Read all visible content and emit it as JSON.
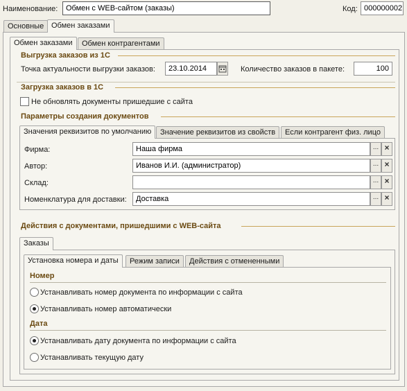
{
  "header": {
    "name_label": "Наименование:",
    "name_value": "Обмен с WEB-сайтом (заказы)",
    "code_label": "Код:",
    "code_value": "000000002"
  },
  "main_tabs": [
    {
      "label": "Основные"
    },
    {
      "label": "Обмен заказами"
    }
  ],
  "sub_tabs": [
    {
      "label": "Обмен заказами"
    },
    {
      "label": "Обмен контрагентами"
    }
  ],
  "export": {
    "title": "Выгрузка заказов из 1С",
    "date_label": "Точка актуальности выгрузки заказов:",
    "date_value": "23.10.2014",
    "packet_label": "Количество заказов в пакете:",
    "packet_value": "100"
  },
  "import": {
    "title": "Загрузка заказов в 1С",
    "checkbox_label": "Не обновлять документы пришедшие с сайта",
    "params_title": "Параметры создания документов",
    "param_tabs": [
      {
        "label": "Значения реквизитов по умолчанию"
      },
      {
        "label": "Значение реквизитов из свойств"
      },
      {
        "label": "Если контрагент физ. лицо"
      }
    ],
    "fields": [
      {
        "label": "Фирма:",
        "value": "Наша фирма"
      },
      {
        "label": "Автор:",
        "value": "Иванов И.И. (администратор)"
      },
      {
        "label": "Склад:",
        "value": ""
      },
      {
        "label": "Номенклатура для доставки:",
        "value": "Доставка"
      }
    ],
    "ellipsis": "...",
    "clear": "×"
  },
  "actions": {
    "title": "Действия с документами, пришедшими с WEB-сайта",
    "orders_tab": "Заказы",
    "inner_tabs": [
      {
        "label": "Установка номера и даты"
      },
      {
        "label": "Режим записи"
      },
      {
        "label": "Действия с отмененными"
      }
    ],
    "number_title": "Номер",
    "number_options": [
      {
        "label": "Устанавливать номер документа по информации с сайта",
        "selected": false
      },
      {
        "label": "Устанавливать номер автоматически",
        "selected": true
      }
    ],
    "date_title": "Дата",
    "date_options": [
      {
        "label": "Устанавливать дату документа по информации с сайта",
        "selected": true
      },
      {
        "label": "Устанавливать текущую дату",
        "selected": false
      }
    ]
  },
  "colors": {
    "background": "#f2f0e8",
    "group_title": "#6b4a12",
    "group_line": "#c9a55a"
  },
  "icons": [
    "calendar-icon",
    "ellipsis-icon",
    "clear-icon"
  ]
}
